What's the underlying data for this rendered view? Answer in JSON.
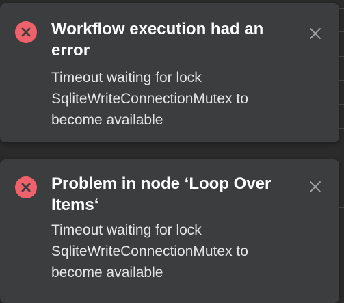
{
  "colors": {
    "toast_background": "#3c3d3f",
    "error_icon": "#f0626b",
    "title_text": "#ffffff",
    "message_text": "#e6e6e6",
    "close_icon": "#a8a8ab"
  },
  "notifications": [
    {
      "icon": "error-circle-x-icon",
      "title": "Workflow execution had an error",
      "message": "Timeout waiting for lock SqliteWriteConnectionMutex to become available",
      "close_icon": "close-icon"
    },
    {
      "icon": "error-circle-x-icon",
      "title": "Problem in node ‘Loop Over Items‘",
      "message": "Timeout waiting for lock SqliteWriteConnectionMutex to become available",
      "close_icon": "close-icon"
    }
  ]
}
